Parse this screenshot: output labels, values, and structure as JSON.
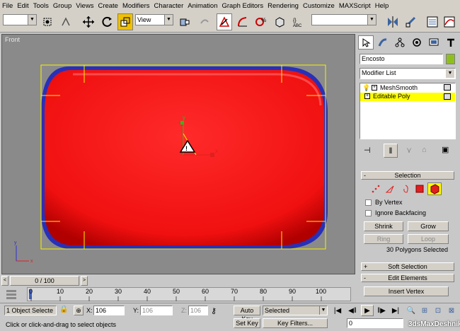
{
  "menu": [
    "File",
    "Edit",
    "Tools",
    "Group",
    "Views",
    "Create",
    "Modifiers",
    "Character",
    "Animation",
    "Graph Editors",
    "Rendering",
    "Customize",
    "MAXScript",
    "Help"
  ],
  "toolbar": {
    "selection_set": "",
    "ref_coord": "View",
    "named_sel": ""
  },
  "viewport": {
    "label": "Front",
    "object_color": "#ff1a1a",
    "gizmo_y": "y",
    "gizmo_x": "x",
    "axis_y": "y",
    "axis_x": "x"
  },
  "panel": {
    "object_name": "Encosto",
    "object_color": "#8fbf1f",
    "modifier_list": "Modifier List",
    "stack": [
      {
        "label": "MeshSmooth",
        "active": false
      },
      {
        "label": "Editable Poly",
        "active": true
      }
    ],
    "rollouts": {
      "selection": "Selection",
      "selection_sign": "-",
      "by_vertex": "By Vertex",
      "ignore_backfacing": "Ignore Backfacing",
      "shrink": "Shrink",
      "grow": "Grow",
      "ring": "Ring",
      "loop": "Loop",
      "selected_count": "30 Polygons Selected",
      "soft_selection": "Soft Selection",
      "soft_sign": "+",
      "edit_elements": "Edit Elements",
      "edit_sign": "-",
      "insert_vertex": "Insert Vertex"
    }
  },
  "timeline": {
    "frame": "0 / 100",
    "ticks": [
      "0",
      "10",
      "20",
      "30",
      "40",
      "50",
      "60",
      "70",
      "80",
      "90",
      "100"
    ]
  },
  "status": {
    "selection": "1 Object Selecte",
    "x_label": "X:",
    "x_value": "106",
    "y_label": "Y:",
    "y_value": "106",
    "z_label": "Z:",
    "z_value": "106",
    "auto_key": "Auto Key",
    "set_key": "Set Key",
    "key_mode": "Selected",
    "key_filters": "Key Filters...",
    "prompt": "Click or click-and-drag to select objects",
    "current_frame": "0",
    "watermark": "3dsMaxDeshnik"
  }
}
